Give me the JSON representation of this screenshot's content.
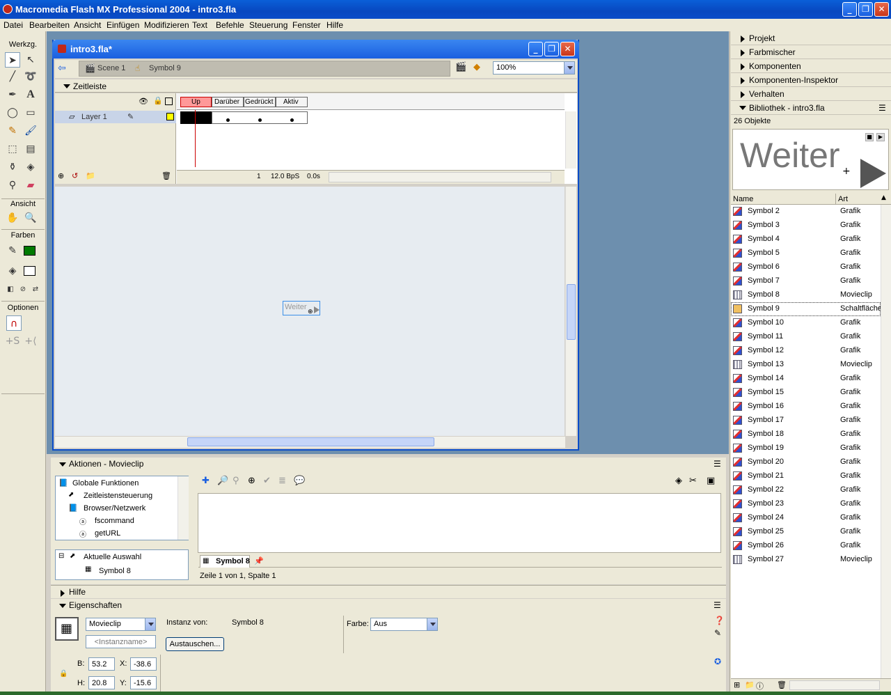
{
  "window": {
    "title": "Macromedia Flash MX Professional 2004 - intro3.fla"
  },
  "menu": [
    "Datei",
    "Bearbeiten",
    "Ansicht",
    "Einfügen",
    "Modifizieren",
    "Text",
    "Befehle",
    "Steuerung",
    "Fenster",
    "Hilfe"
  ],
  "toolbox": {
    "tools_label": "Werkzg.",
    "view_label": "Ansicht",
    "colors_label": "Farben",
    "options_label": "Optionen",
    "stroke_color": "#000000",
    "fill_color": "#007a00"
  },
  "document": {
    "title": "intro3.fla*",
    "scene": "Scene 1",
    "symbol": "Symbol 9",
    "zoom": "100%"
  },
  "timeline": {
    "header": "Zeitleiste",
    "layer": "Layer 1",
    "frames": [
      "Up",
      "Darüber",
      "Gedrückt",
      "Aktiv"
    ],
    "current_frame": "1",
    "fps": "12.0 BpS",
    "time": "0.0s"
  },
  "stage": {
    "button_text": "Weiter"
  },
  "right_panels": {
    "items": [
      "Projekt",
      "Farbmischer",
      "Komponenten",
      "Komponenten-Inspektor",
      "Verhalten"
    ],
    "library_title": "Bibliothek - intro3.fla",
    "object_count": "26 Objekte",
    "preview_text": "Weiter",
    "col_name": "Name",
    "col_kind": "Art",
    "rows": [
      {
        "name": "Symbol 2",
        "kind": "Grafik"
      },
      {
        "name": "Symbol 3",
        "kind": "Grafik"
      },
      {
        "name": "Symbol 4",
        "kind": "Grafik"
      },
      {
        "name": "Symbol 5",
        "kind": "Grafik"
      },
      {
        "name": "Symbol 6",
        "kind": "Grafik"
      },
      {
        "name": "Symbol 7",
        "kind": "Grafik"
      },
      {
        "name": "Symbol 8",
        "kind": "Movieclip"
      },
      {
        "name": "Symbol 9",
        "kind": "Schaltfläche"
      },
      {
        "name": "Symbol 10",
        "kind": "Grafik"
      },
      {
        "name": "Symbol 11",
        "kind": "Grafik"
      },
      {
        "name": "Symbol 12",
        "kind": "Grafik"
      },
      {
        "name": "Symbol 13",
        "kind": "Movieclip"
      },
      {
        "name": "Symbol 14",
        "kind": "Grafik"
      },
      {
        "name": "Symbol 15",
        "kind": "Grafik"
      },
      {
        "name": "Symbol 16",
        "kind": "Grafik"
      },
      {
        "name": "Symbol 17",
        "kind": "Grafik"
      },
      {
        "name": "Symbol 18",
        "kind": "Grafik"
      },
      {
        "name": "Symbol 19",
        "kind": "Grafik"
      },
      {
        "name": "Symbol 20",
        "kind": "Grafik"
      },
      {
        "name": "Symbol 21",
        "kind": "Grafik"
      },
      {
        "name": "Symbol 22",
        "kind": "Grafik"
      },
      {
        "name": "Symbol 23",
        "kind": "Grafik"
      },
      {
        "name": "Symbol 24",
        "kind": "Grafik"
      },
      {
        "name": "Symbol 25",
        "kind": "Grafik"
      },
      {
        "name": "Symbol 26",
        "kind": "Grafik"
      },
      {
        "name": "Symbol 27",
        "kind": "Movieclip"
      }
    ]
  },
  "actions": {
    "header": "Aktionen - Movieclip",
    "tree": [
      {
        "label": "Globale Funktionen"
      },
      {
        "label": "Zeitleistensteuerung"
      },
      {
        "label": "Browser/Netzwerk"
      },
      {
        "label": "fscommand"
      },
      {
        "label": "getURL"
      }
    ],
    "current_selection": "Aktuelle Auswahl",
    "current_symbol": "Symbol 8",
    "tab": "Symbol 8",
    "status": "Zeile 1 von 1, Spalte 1"
  },
  "help": {
    "header": "Hilfe"
  },
  "properties": {
    "header": "Eigenschaften",
    "type": "Movieclip",
    "instance_placeholder": "<Instanzname>",
    "instance_of_label": "Instanz von:",
    "instance_of": "Symbol 8",
    "swap_label": "Austauschen...",
    "color_label": "Farbe:",
    "color_value": "Aus",
    "w_label": "B:",
    "w": "53.2",
    "x_label": "X:",
    "x": "-38.6",
    "h_label": "H:",
    "h": "20.8",
    "y_label": "Y:",
    "y": "-15.6"
  }
}
